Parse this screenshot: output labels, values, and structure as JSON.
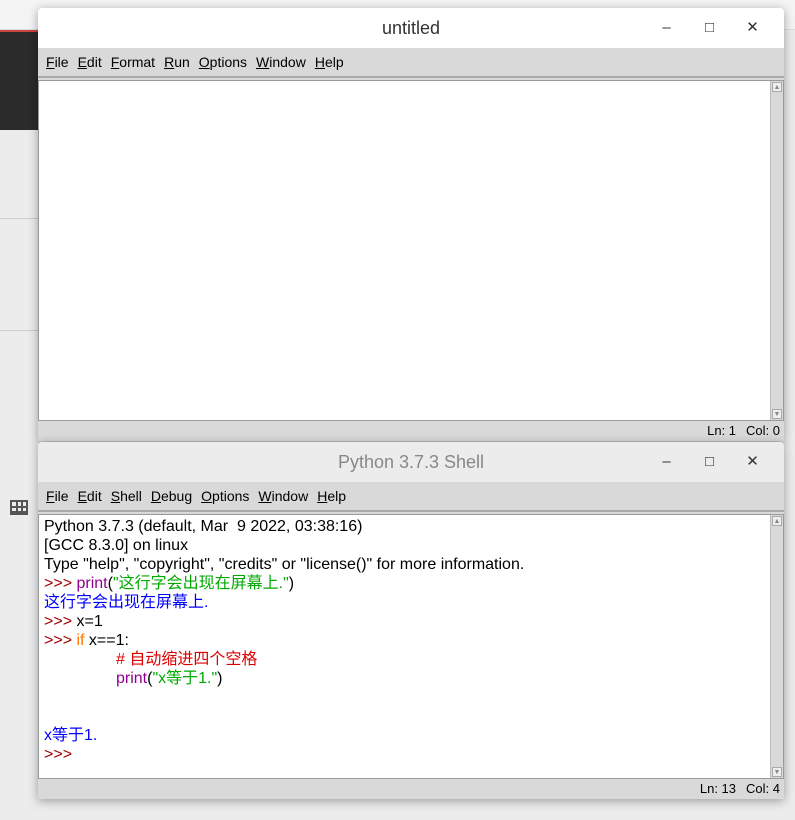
{
  "editor": {
    "title": "untitled",
    "menu": [
      "File",
      "Edit",
      "Format",
      "Run",
      "Options",
      "Window",
      "Help"
    ],
    "status": {
      "ln": "Ln: 1",
      "col": "Col: 0"
    }
  },
  "shell": {
    "title": "Python 3.7.3 Shell",
    "menu": [
      "File",
      "Edit",
      "Shell",
      "Debug",
      "Options",
      "Window",
      "Help"
    ],
    "banner": [
      "Python 3.7.3 (default, Mar  9 2022, 03:38:16)",
      "[GCC 8.3.0] on linux",
      "Type \"help\", \"copyright\", \"credits\" or \"license()\" for more information."
    ],
    "prompt": ">>> ",
    "l1_fn": "print",
    "l1_open": "(",
    "l1_str": "\"这行字会出现在屏幕上.\"",
    "l1_close": ")",
    "out1": "这行字会出现在屏幕上.",
    "l2": "x=1",
    "l3_kw": "if",
    "l3_rest": " x==1:",
    "l4_comment": "# 自动缩进四个空格",
    "l5_fn": "print",
    "l5_open": "(",
    "l5_str": "\"x等于1.\"",
    "l5_close": ")",
    "out2": "x等于1.",
    "status": {
      "ln": "Ln: 13",
      "col": "Col: 4"
    }
  },
  "window_controls": {
    "minimize": "–",
    "maximize": "□",
    "close": "✕"
  }
}
